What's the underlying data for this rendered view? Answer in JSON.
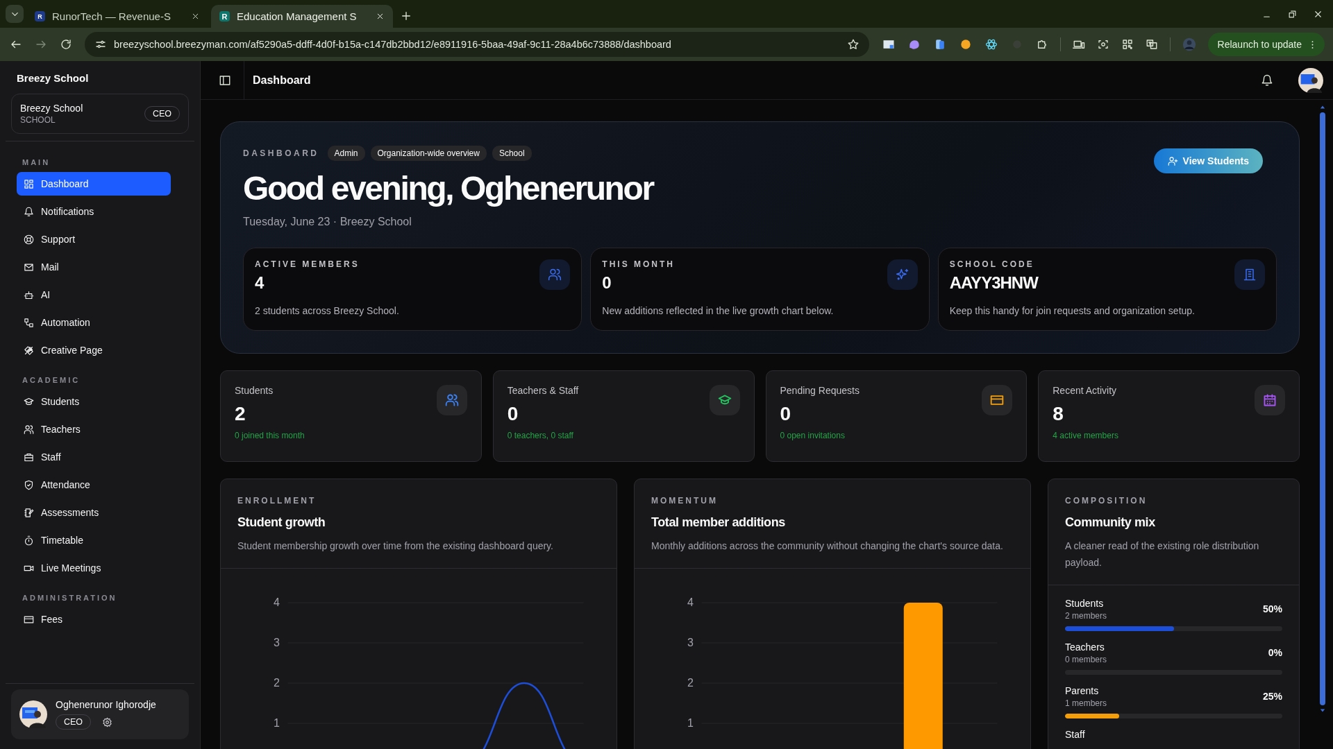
{
  "browser": {
    "tabs": [
      {
        "title": "RunorTech — Revenue-S",
        "favicon": "R",
        "selected": false
      },
      {
        "title": "Education Management S",
        "favicon": "R",
        "selected": true
      }
    ],
    "url": "breezyschool.breezyman.com/af5290a5-ddff-4d0f-b15a-c147db2bbd12/e8911916-5baa-49af-9c11-28a4b6c73888/dashboard",
    "relaunch": "Relaunch to update"
  },
  "sidebar": {
    "brand": "Breezy School",
    "org": {
      "name": "Breezy School",
      "type": "SCHOOL",
      "role": "CEO"
    },
    "sections": [
      {
        "title": "MAIN",
        "items": [
          {
            "label": "Dashboard",
            "selected": true
          },
          {
            "label": "Notifications",
            "selected": false
          },
          {
            "label": "Support",
            "selected": false
          },
          {
            "label": "Mail",
            "selected": false
          },
          {
            "label": "AI",
            "selected": false
          },
          {
            "label": "Automation",
            "selected": false
          },
          {
            "label": "Creative Page",
            "selected": false
          }
        ]
      },
      {
        "title": "ACADEMIC",
        "items": [
          {
            "label": "Students",
            "selected": false
          },
          {
            "label": "Teachers",
            "selected": false
          },
          {
            "label": "Staff",
            "selected": false
          },
          {
            "label": "Attendance",
            "selected": false
          },
          {
            "label": "Assessments",
            "selected": false
          },
          {
            "label": "Timetable",
            "selected": false
          },
          {
            "label": "Live Meetings",
            "selected": false
          }
        ]
      },
      {
        "title": "ADMINISTRATION",
        "items": [
          {
            "label": "Fees",
            "selected": false
          }
        ]
      }
    ],
    "user": {
      "name": "Oghenerunor Ighorodje",
      "role": "CEO"
    }
  },
  "header": {
    "title": "Dashboard"
  },
  "hero": {
    "eyebrow": "DASHBOARD",
    "tags": [
      "Admin",
      "Organization-wide overview",
      "School"
    ],
    "greeting": "Good evening, Oghenerunor",
    "subtitle": "Tuesday, June 23 · Breezy School",
    "action": "View Students",
    "cards": [
      {
        "label": "ACTIVE MEMBERS",
        "value": "4",
        "note": "2 students across Breezy School."
      },
      {
        "label": "THIS MONTH",
        "value": "0",
        "note": "New additions reflected in the live growth chart below."
      },
      {
        "label": "SCHOOL CODE",
        "value": "AAYY3HNW",
        "note": "Keep this handy for join requests and organization setup."
      }
    ]
  },
  "stats": [
    {
      "label": "Students",
      "value": "2",
      "note": "0 joined this month",
      "color": "#3b82f6"
    },
    {
      "label": "Teachers & Staff",
      "value": "0",
      "note": "0 teachers, 0 staff",
      "color": "#22c55e"
    },
    {
      "label": "Pending Requests",
      "value": "0",
      "note": "0 open invitations",
      "color": "#f59e0b"
    },
    {
      "label": "Recent Activity",
      "value": "8",
      "note": "4 active members",
      "color": "#a855f7"
    }
  ],
  "panels": [
    {
      "kind": "line_chart",
      "eyebrow": "ENROLLMENT",
      "title": "Student growth",
      "description": "Student membership growth over time from the existing dashboard query.",
      "axis_labels": [
        "4",
        "3",
        "2",
        "1"
      ]
    },
    {
      "kind": "bar_chart",
      "eyebrow": "MOMENTUM",
      "title": "Total member additions",
      "description": "Monthly additions across the community without changing the chart's source data.",
      "axis_labels": [
        "4",
        "3",
        "2",
        "1"
      ]
    },
    {
      "kind": "mix",
      "eyebrow": "COMPOSITION",
      "title": "Community mix",
      "description": "A cleaner read of the existing role distribution payload.",
      "items": [
        {
          "label": "Students",
          "members": "2 members",
          "percent": "50%",
          "level": 0.5,
          "color": "#1d4ed8"
        },
        {
          "label": "Teachers",
          "members": "0 members",
          "percent": "0%",
          "level": 0
        },
        {
          "label": "Parents",
          "members": "1 members",
          "percent": "25%",
          "level": 0.25,
          "color": "#f59e0b"
        },
        {
          "label": "Staff"
        }
      ]
    }
  ]
}
